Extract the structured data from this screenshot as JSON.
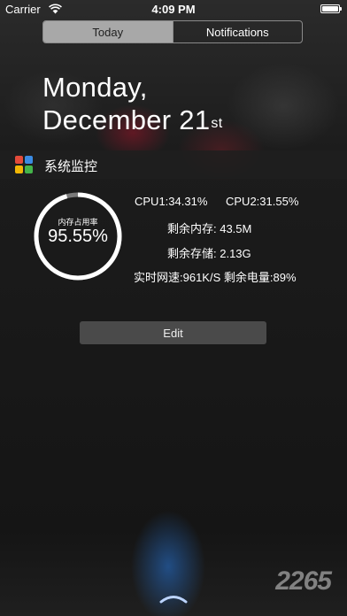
{
  "status_bar": {
    "carrier": "Carrier",
    "time": "4:09 PM",
    "battery_percent": "",
    "battery_level": 1.0
  },
  "tabs": [
    {
      "label": "Today",
      "active": true
    },
    {
      "label": "Notifications",
      "active": false
    }
  ],
  "date": {
    "weekday": "Monday,",
    "month_day": "December 21",
    "suffix": "st"
  },
  "widget": {
    "title": "系统监控",
    "icon": "app-grid-icon",
    "gauge": {
      "label": "内存占用率",
      "value_text": "95.55%",
      "value": 0.9555
    },
    "stats": {
      "cpu1": "CPU1:34.31%",
      "cpu2": "CPU2:31.55%",
      "free_memory": "剩余内存: 43.5M",
      "free_storage": "剩余存储: 2.13G",
      "net_and_battery": "实时网速:961K/S 剩余电量:89%"
    },
    "edit_label": "Edit"
  },
  "watermark": "2265",
  "colors": {
    "gauge_track": "#7a7a7a",
    "gauge_fill": "#ffffff",
    "segment_active": "#a8a8a8",
    "edit_button": "#4a4a4a"
  }
}
